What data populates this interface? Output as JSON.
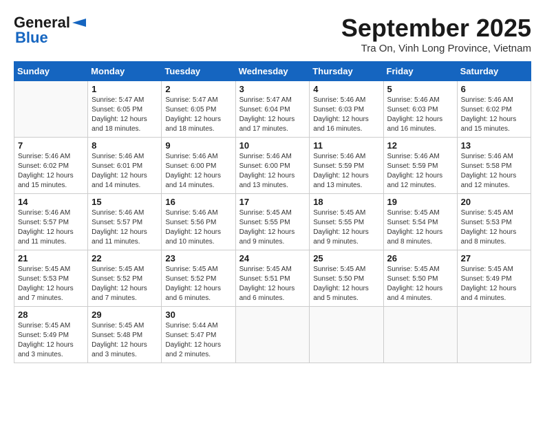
{
  "header": {
    "logo": {
      "general": "General",
      "blue": "Blue"
    },
    "month": "September 2025",
    "location": "Tra On, Vinh Long Province, Vietnam"
  },
  "weekdays": [
    "Sunday",
    "Monday",
    "Tuesday",
    "Wednesday",
    "Thursday",
    "Friday",
    "Saturday"
  ],
  "weeks": [
    [
      {
        "day": "",
        "info": ""
      },
      {
        "day": "1",
        "info": "Sunrise: 5:47 AM\nSunset: 6:05 PM\nDaylight: 12 hours\nand 18 minutes."
      },
      {
        "day": "2",
        "info": "Sunrise: 5:47 AM\nSunset: 6:05 PM\nDaylight: 12 hours\nand 18 minutes."
      },
      {
        "day": "3",
        "info": "Sunrise: 5:47 AM\nSunset: 6:04 PM\nDaylight: 12 hours\nand 17 minutes."
      },
      {
        "day": "4",
        "info": "Sunrise: 5:46 AM\nSunset: 6:03 PM\nDaylight: 12 hours\nand 16 minutes."
      },
      {
        "day": "5",
        "info": "Sunrise: 5:46 AM\nSunset: 6:03 PM\nDaylight: 12 hours\nand 16 minutes."
      },
      {
        "day": "6",
        "info": "Sunrise: 5:46 AM\nSunset: 6:02 PM\nDaylight: 12 hours\nand 15 minutes."
      }
    ],
    [
      {
        "day": "7",
        "info": "Sunrise: 5:46 AM\nSunset: 6:02 PM\nDaylight: 12 hours\nand 15 minutes."
      },
      {
        "day": "8",
        "info": "Sunrise: 5:46 AM\nSunset: 6:01 PM\nDaylight: 12 hours\nand 14 minutes."
      },
      {
        "day": "9",
        "info": "Sunrise: 5:46 AM\nSunset: 6:00 PM\nDaylight: 12 hours\nand 14 minutes."
      },
      {
        "day": "10",
        "info": "Sunrise: 5:46 AM\nSunset: 6:00 PM\nDaylight: 12 hours\nand 13 minutes."
      },
      {
        "day": "11",
        "info": "Sunrise: 5:46 AM\nSunset: 5:59 PM\nDaylight: 12 hours\nand 13 minutes."
      },
      {
        "day": "12",
        "info": "Sunrise: 5:46 AM\nSunset: 5:59 PM\nDaylight: 12 hours\nand 12 minutes."
      },
      {
        "day": "13",
        "info": "Sunrise: 5:46 AM\nSunset: 5:58 PM\nDaylight: 12 hours\nand 12 minutes."
      }
    ],
    [
      {
        "day": "14",
        "info": "Sunrise: 5:46 AM\nSunset: 5:57 PM\nDaylight: 12 hours\nand 11 minutes."
      },
      {
        "day": "15",
        "info": "Sunrise: 5:46 AM\nSunset: 5:57 PM\nDaylight: 12 hours\nand 11 minutes."
      },
      {
        "day": "16",
        "info": "Sunrise: 5:46 AM\nSunset: 5:56 PM\nDaylight: 12 hours\nand 10 minutes."
      },
      {
        "day": "17",
        "info": "Sunrise: 5:45 AM\nSunset: 5:55 PM\nDaylight: 12 hours\nand 9 minutes."
      },
      {
        "day": "18",
        "info": "Sunrise: 5:45 AM\nSunset: 5:55 PM\nDaylight: 12 hours\nand 9 minutes."
      },
      {
        "day": "19",
        "info": "Sunrise: 5:45 AM\nSunset: 5:54 PM\nDaylight: 12 hours\nand 8 minutes."
      },
      {
        "day": "20",
        "info": "Sunrise: 5:45 AM\nSunset: 5:53 PM\nDaylight: 12 hours\nand 8 minutes."
      }
    ],
    [
      {
        "day": "21",
        "info": "Sunrise: 5:45 AM\nSunset: 5:53 PM\nDaylight: 12 hours\nand 7 minutes."
      },
      {
        "day": "22",
        "info": "Sunrise: 5:45 AM\nSunset: 5:52 PM\nDaylight: 12 hours\nand 7 minutes."
      },
      {
        "day": "23",
        "info": "Sunrise: 5:45 AM\nSunset: 5:52 PM\nDaylight: 12 hours\nand 6 minutes."
      },
      {
        "day": "24",
        "info": "Sunrise: 5:45 AM\nSunset: 5:51 PM\nDaylight: 12 hours\nand 6 minutes."
      },
      {
        "day": "25",
        "info": "Sunrise: 5:45 AM\nSunset: 5:50 PM\nDaylight: 12 hours\nand 5 minutes."
      },
      {
        "day": "26",
        "info": "Sunrise: 5:45 AM\nSunset: 5:50 PM\nDaylight: 12 hours\nand 4 minutes."
      },
      {
        "day": "27",
        "info": "Sunrise: 5:45 AM\nSunset: 5:49 PM\nDaylight: 12 hours\nand 4 minutes."
      }
    ],
    [
      {
        "day": "28",
        "info": "Sunrise: 5:45 AM\nSunset: 5:49 PM\nDaylight: 12 hours\nand 3 minutes."
      },
      {
        "day": "29",
        "info": "Sunrise: 5:45 AM\nSunset: 5:48 PM\nDaylight: 12 hours\nand 3 minutes."
      },
      {
        "day": "30",
        "info": "Sunrise: 5:44 AM\nSunset: 5:47 PM\nDaylight: 12 hours\nand 2 minutes."
      },
      {
        "day": "",
        "info": ""
      },
      {
        "day": "",
        "info": ""
      },
      {
        "day": "",
        "info": ""
      },
      {
        "day": "",
        "info": ""
      }
    ]
  ]
}
